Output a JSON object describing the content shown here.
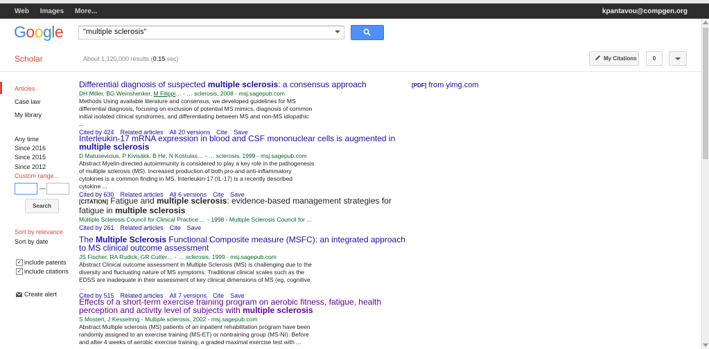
{
  "topbar": {
    "links": [
      "Web",
      "Images",
      "More..."
    ],
    "user": "kpantavou@compgen.org"
  },
  "logo": "Google",
  "search": {
    "value": "\"multiple sclerosis\""
  },
  "scholar_label": "Scholar",
  "result_count": {
    "prefix": "About 1,120,000 results (",
    "time": "0.15",
    "suffix": " sec)"
  },
  "my_citations": "My Citations",
  "alert_count": "0",
  "sidebar": {
    "type_items": [
      "Articles",
      "Case law",
      "My library"
    ],
    "time_items": [
      "Any time",
      "Since 2016",
      "Since 2015",
      "Since 2012",
      "Custom range..."
    ],
    "range_dash": "—",
    "search_button": "Search",
    "sort_items": [
      "Sort by relevance",
      "Sort by date"
    ],
    "checkboxes": [
      "include patents",
      "include citations"
    ],
    "create_alert": "Create alert"
  },
  "side_link": {
    "tag": "[PDF]",
    "text": " from yimg.com"
  },
  "results": [
    {
      "title_parts": [
        [
          "Differential diagnosis of suspected ",
          false
        ],
        [
          "multiple sclerosis",
          true
        ],
        [
          ": a consensus approach",
          false
        ]
      ],
      "authors": "DH Miller, BG Weinshenker, ",
      "author_link": "M Filippi",
      "source": "… - … sclerosis, 2008 - msj.sagepub.com",
      "snippet": "Methods Using available literature and consensus, we developed guidelines for MS differential diagnosis, focusing on exclusion of potential MS mimics, diagnosis of common initial isolated clinical syndromes, and differentiating between MS and non-MS idiopathic ...",
      "actions": [
        "Cited by 424",
        "Related articles",
        "All 20 versions",
        "Cite",
        "Save"
      ]
    },
    {
      "title_parts": [
        [
          "Interleukin-17 mRNA expression in blood and CSF mononuclear cells is augmented in ",
          false
        ],
        [
          "multiple sclerosis",
          true
        ]
      ],
      "authors": "D Matusevicius, P Kivisäkk, B He, N Kostulas… - … sclerosis, 1999 - msj.sagepub.com",
      "snippet": "Abstract Myelin-directed autoimmunity is considered to play a key role in the pathogenesis of multiple sclerosis (MS). Increased production of both pro-and anti-inflammatory cytokines is a common finding in MS. Interleukin-17 (IL-17) is a recently described cytokine ...",
      "actions": [
        "Cited by 630",
        "Related articles",
        "All 6 versions",
        "Cite",
        "Save"
      ]
    },
    {
      "tag": "[CITATION]",
      "title_parts": [
        [
          "Fatigue and ",
          false
        ],
        [
          "multiple sclerosis",
          true
        ],
        [
          ": evidence-based management strategies for fatigue in ",
          false
        ],
        [
          "multiple sclerosis",
          true
        ]
      ],
      "authors": "Multiple Sclerosis Council for Clinical Practice … - 1998 - Multiple Sclerosis Council for ...",
      "actions": [
        "Cited by 261",
        "Related articles",
        "Cite",
        "Save"
      ]
    },
    {
      "title_parts": [
        [
          "The ",
          false
        ],
        [
          "Multiple Sclerosis",
          true
        ],
        [
          " Functional Composite measure (MSFC): an integrated approach to MS clinical outcome assessment",
          false
        ]
      ],
      "authors": "JS Fischer, RA Rudick, GR Cutter… - … sclerosis, 1999 - msj.sagepub.com",
      "snippet": "Abstract Clinical outcome assessment in Multiple Sclerosis (MS) is challenging due to the diversity and fluctuating nature of MS symptoms. Traditional clinical scales such as the EDSS are inadequate in their assessment of key clinical dimensions of MS (eg, cognitive ...",
      "actions": [
        "Cited by 515",
        "Related articles",
        "All 7 versions",
        "Cite",
        "Save"
      ]
    },
    {
      "title_parts": [
        [
          "Effects of a short-term exercise training program on aerobic fitness, fatigue, health perception and activity level of subjects with ",
          false
        ],
        [
          "multiple sclerosis",
          true
        ]
      ],
      "authors": "S Mostert, J Kesselring - Multiple sclerosis, 2002 - msj.sagepub.com",
      "snippet": "Abstract Multiple sclerosis (MS) patients of an inpatient rehabilitation program have been randomly assigned to an exercise training (MS-ET) or nontraining group (MS-NI). Before and after 4 weeks of aerobic exercise training, a graded maximal exercise test with ..."
    }
  ],
  "colors": {
    "accent": "#4d90fe",
    "scholar_red": "#dd4b39",
    "link": "#1a0dab",
    "source_green": "#006621"
  }
}
